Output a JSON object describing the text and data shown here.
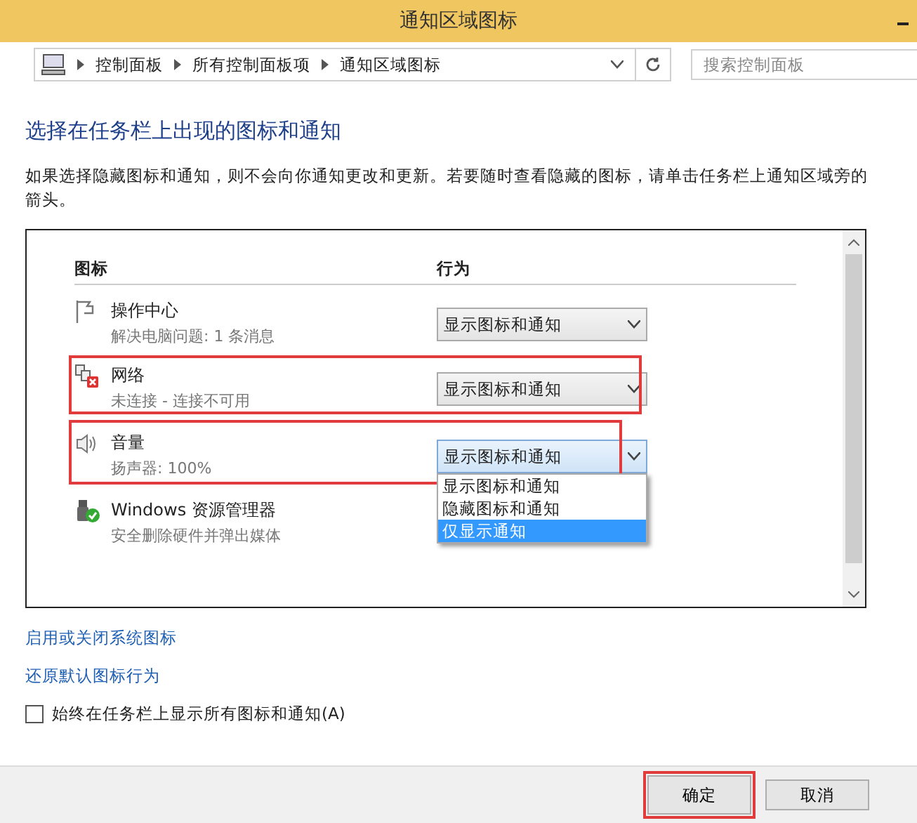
{
  "window": {
    "title": "通知区域图标"
  },
  "address_bar": {
    "crumbs": [
      "控制面板",
      "所有控制面板项",
      "通知区域图标"
    ]
  },
  "search": {
    "placeholder": "搜索控制面板"
  },
  "heading": "选择在任务栏上出现的图标和通知",
  "description": "如果选择隐藏图标和通知，则不会向你通知更改和更新。若要随时查看隐藏的图标，请单击任务栏上通知区域旁的箭头。",
  "table": {
    "columns": [
      "图标",
      "行为"
    ],
    "rows": [
      {
        "kind": "flag",
        "name": "操作中心",
        "detail": "解决电脑问题: 1 条消息",
        "behavior": "显示图标和通知",
        "highlighted": false,
        "expanded": false
      },
      {
        "kind": "network",
        "name": "网络",
        "detail": "未连接 - 连接不可用",
        "behavior": "显示图标和通知",
        "highlighted": true,
        "expanded": false
      },
      {
        "kind": "speaker",
        "name": "音量",
        "detail": "扬声器: 100%",
        "behavior": "显示图标和通知",
        "highlighted": true,
        "expanded": true,
        "options": [
          {
            "label": "显示图标和通知",
            "selected": false
          },
          {
            "label": "隐藏图标和通知",
            "selected": false
          },
          {
            "label": "仅显示通知",
            "selected": true
          }
        ]
      },
      {
        "kind": "usb",
        "name": "Windows 资源管理器",
        "detail": "安全删除硬件并弹出媒体",
        "behavior": "",
        "highlighted": false,
        "expanded": false
      }
    ]
  },
  "links": [
    "启用或关闭系统图标",
    "还原默认图标行为"
  ],
  "checkbox": {
    "label": "始终在任务栏上显示所有图标和通知(A)",
    "checked": false
  },
  "buttons": [
    {
      "label": "确定",
      "highlighted": true
    },
    {
      "label": "取消",
      "highlighted": false
    }
  ]
}
